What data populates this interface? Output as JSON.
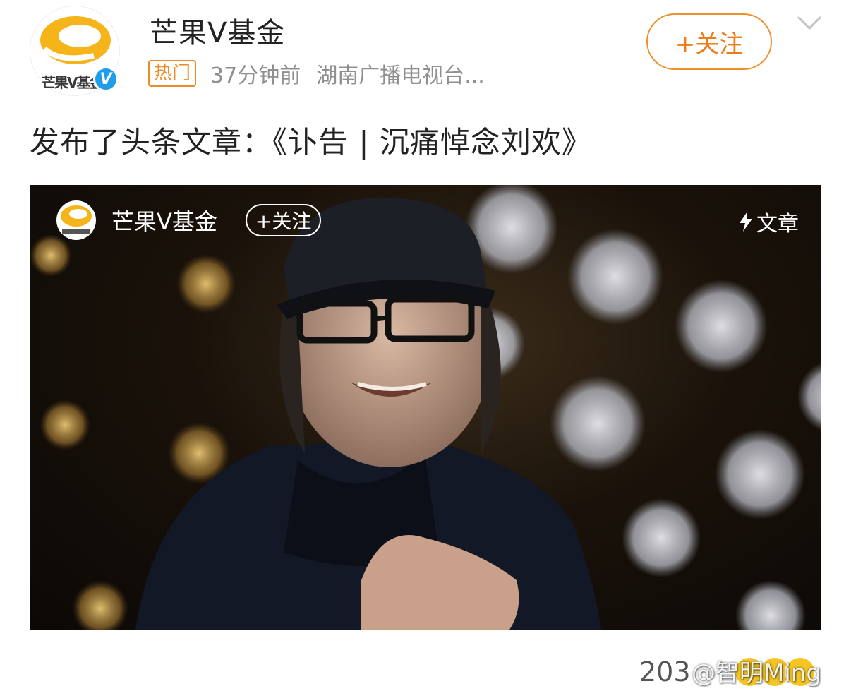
{
  "post": {
    "author": {
      "name": "芒果V基金",
      "avatar_logo_text": "芒果V基金",
      "verified_badge": "V"
    },
    "tag": "热门",
    "time": "37分钟前",
    "source": "湖南广播电视台...",
    "follow_label": "+关注",
    "text": "发布了头条文章：《讣告 | 沉痛悼念刘欢》",
    "card": {
      "author_name": "芒果V基金",
      "follow_label": "+关注",
      "type_label": "文章"
    },
    "engagement_count": "203",
    "watermark": "@智明Ming"
  },
  "colors": {
    "accent_orange": "#f08a24",
    "verified_blue": "#1f9dea",
    "text_primary": "#222222",
    "text_secondary": "#8f8f8f"
  },
  "icons": [
    "chevron-down-icon",
    "lightning-icon",
    "mango-logo-icon",
    "verified-icon",
    "reaction-icon"
  ]
}
